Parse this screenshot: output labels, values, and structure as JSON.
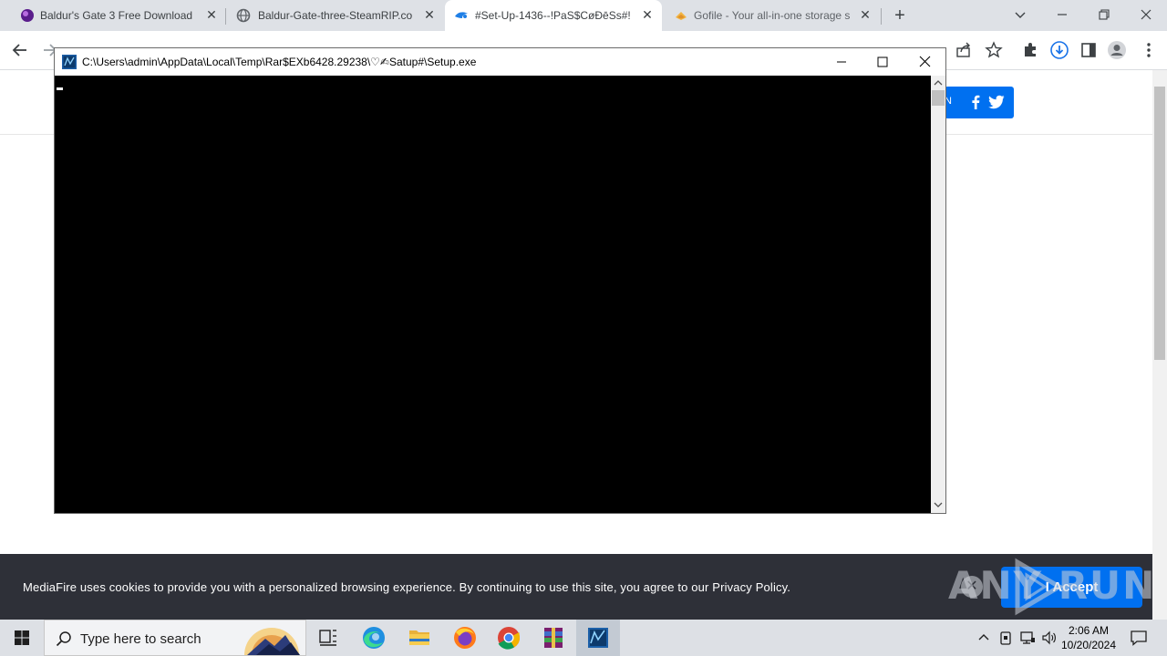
{
  "browser": {
    "tabs": [
      {
        "title": "Baldur's Gate 3 Free Download (",
        "active": false
      },
      {
        "title": "Baldur-Gate-three-SteamRIP.co",
        "active": false
      },
      {
        "title": "#Set-Up-1436--!PaS$CøĐēSs#!!",
        "active": true
      },
      {
        "title": "Gofile - Your all-in-one storage s",
        "active": false
      }
    ],
    "close_glyph": "✕",
    "new_tab_glyph": "+"
  },
  "page": {
    "share_partial": "N",
    "cookie_text": "MediaFire uses cookies to provide you with a personalized browsing experience. By continuing to use this site, you agree to our Privacy Policy.",
    "accept_label": "I Accept",
    "close_glyph": "✕"
  },
  "console": {
    "title": "C:\\Users\\admin\\AppData\\Local\\Temp\\Rar$EXb6428.29238\\♡✍Satup#\\Setup.exe"
  },
  "watermark": {
    "text": "ANY RUN"
  },
  "taskbar": {
    "search_placeholder": "Type here to search",
    "time": "2:06 AM",
    "date": "10/20/2024"
  },
  "colors": {
    "accent": "#0070f0",
    "cookie_bg": "#2e3038",
    "console_bg": "#000000"
  }
}
